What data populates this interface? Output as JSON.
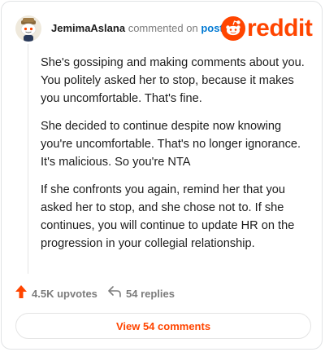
{
  "header": {
    "username": "JemimaAslana",
    "commented_text": "commented on",
    "post_link": "post",
    "brand": "reddit"
  },
  "comment": {
    "paragraphs": [
      "She's gossiping and making comments about you. You politely asked her to stop, because it makes you uncomfortable. That's fine.",
      "She decided to continue despite now knowing you're uncomfortable. That's no longer ignorance. It's malicious. So you're NTA",
      "If she confronts you again, remind her that you asked her to stop, and she chose not to. If she continues, you will continue to update HR on the progression in your collegial relationship."
    ]
  },
  "actions": {
    "upvotes": "4.5K upvotes",
    "replies": "54 replies",
    "view_comments": "View 54 comments"
  },
  "icons": {
    "avatar": "snoo-avatar-icon",
    "logo": "reddit-snoo-icon",
    "upvote": "upvote-arrow-icon",
    "reply": "reply-arrow-icon"
  },
  "colors": {
    "brand": "#ff4500",
    "link": "#0079d3",
    "muted": "#7c7c7c"
  }
}
